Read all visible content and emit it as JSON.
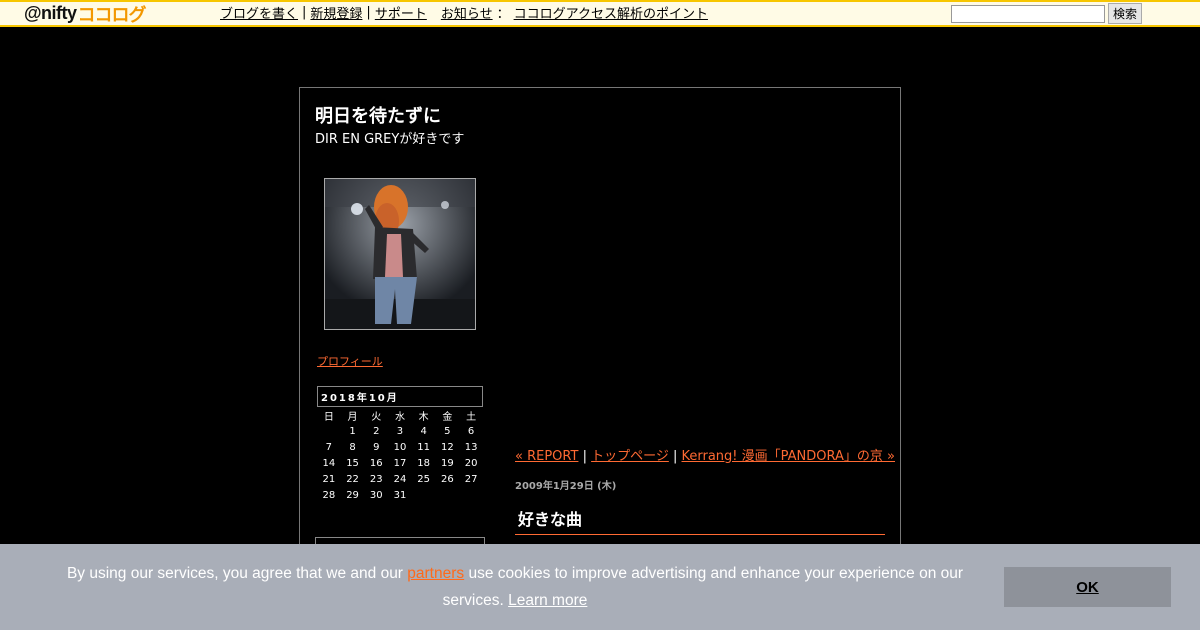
{
  "topbar": {
    "logo_prefix": "@nifty",
    "logo_brand": "ココログ",
    "nav": [
      "ブログを書く",
      "新規登録",
      "サポート"
    ],
    "news_label": "お知らせ",
    "news_colon": "：",
    "news_link": "ココログアクセス解析のポイント",
    "search_value": "",
    "search_button": "検索"
  },
  "blog": {
    "title": "明日を待たずに",
    "description": "DIR EN GREYが好きです",
    "profile_link": "プロフィール"
  },
  "calendar": {
    "caption": "2018年10月",
    "weekdays": [
      "日",
      "月",
      "火",
      "水",
      "木",
      "金",
      "土"
    ],
    "weeks": [
      [
        "",
        "1",
        "2",
        "3",
        "4",
        "5",
        "6"
      ],
      [
        "7",
        "8",
        "9",
        "10",
        "11",
        "12",
        "13"
      ],
      [
        "14",
        "15",
        "16",
        "17",
        "18",
        "19",
        "20"
      ],
      [
        "21",
        "22",
        "23",
        "24",
        "25",
        "26",
        "27"
      ],
      [
        "28",
        "29",
        "30",
        "31",
        "",
        "",
        ""
      ]
    ]
  },
  "entry": {
    "prev_link": "« REPORT",
    "sep1": " | ",
    "top_link": "トップページ",
    "sep2": " | ",
    "next_link": "Kerrang! 漫画「PANDORA」の京 »",
    "date": "2009年1月29日 (木)",
    "title": "好きな曲"
  },
  "cookie": {
    "text_before": "By using our services, you agree that we and our ",
    "partners_link": "partners",
    "text_after": " use cookies to improve advertising and enhance your experience on our services. ",
    "learn_more": "Learn more",
    "ok_label": "OK"
  },
  "colors": {
    "accent": "#ff6a33",
    "topbar_bg": "#fffbe6",
    "topbar_border": "#f7c600",
    "cookie_bg": "#a9aeb8",
    "ok_bg": "#8e929a"
  }
}
